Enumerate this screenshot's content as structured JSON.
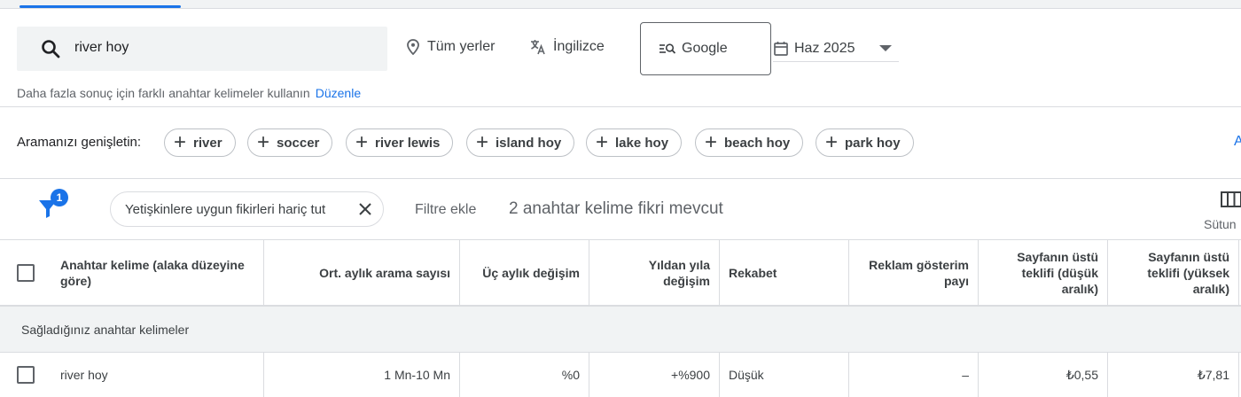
{
  "search": {
    "query": "river hoy",
    "location": "Tüm yerler",
    "language": "İngilizce",
    "engine": "Google",
    "date": "Haz 2025"
  },
  "hint": {
    "text": "Daha fazla sonuç için farklı anahtar kelimeler kullanın",
    "link": "Düzenle"
  },
  "expand": {
    "label": "Aramanızı genişletin:",
    "chips": [
      "river",
      "soccer",
      "river lewis",
      "island hoy",
      "lake hoy",
      "beach hoy",
      "park hoy"
    ],
    "more_link": "A"
  },
  "filters": {
    "badge": "1",
    "active_filter": "Yetişkinlere uygun fikirleri hariç tut",
    "add_filter": "Filtre ekle",
    "ideas_count": "2 anahtar kelime fikri mevcut",
    "columns_label": "Sütun"
  },
  "table": {
    "headers": {
      "keyword": "Anahtar kelime (alaka düzeyine göre)",
      "avg_searches": "Ort. aylık arama sayısı",
      "three_month": "Üç aylık değişim",
      "yoy": "Yıldan yıla değişim",
      "competition": "Rekabet",
      "impression_share": "Reklam gösterim payı",
      "bid_low": "Sayfanın üstü teklifi (düşük aralık)",
      "bid_high": "Sayfanın üstü teklifi (yüksek aralık)"
    },
    "group_label": "Sağladığınız anahtar kelimeler",
    "rows": [
      {
        "keyword": "river hoy",
        "avg_searches": "1 Mn-10 Mn",
        "three_month": "%0",
        "yoy": "+%900",
        "competition": "Düşük",
        "impression_share": "–",
        "bid_low": "₺0,55",
        "bid_high": "₺7,81"
      }
    ]
  },
  "colors": {
    "accent": "#1a73e8",
    "border": "#dadce0",
    "muted": "#f1f3f4"
  }
}
